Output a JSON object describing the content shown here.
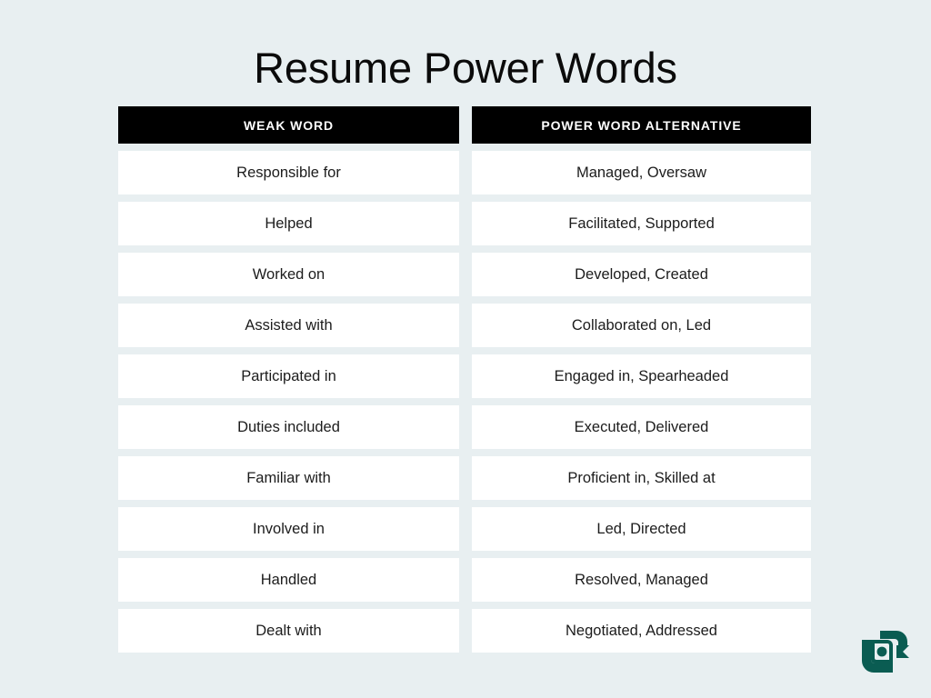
{
  "slide": {
    "title": "Resume Power Words",
    "background_color": "#e8eff1",
    "header_bg_color": "#000000",
    "header_text_color": "#ffffff",
    "cell_bg_color": "#ffffff",
    "cell_text_color": "#1c1c1c",
    "logo_color": "#0a5c52"
  },
  "table": {
    "columns": [
      {
        "header": "WEAK WORD"
      },
      {
        "header": "POWER WORD ALTERNATIVE"
      }
    ],
    "rows": [
      {
        "weak_word": "Responsible for",
        "power_word": "Managed, Oversaw"
      },
      {
        "weak_word": "Helped",
        "power_word": "Facilitated, Supported"
      },
      {
        "weak_word": "Worked on",
        "power_word": "Developed, Created"
      },
      {
        "weak_word": "Assisted with",
        "power_word": "Collaborated on, Led"
      },
      {
        "weak_word": "Participated in",
        "power_word": "Engaged in, Spearheaded"
      },
      {
        "weak_word": "Duties included",
        "power_word": "Executed, Delivered"
      },
      {
        "weak_word": "Familiar with",
        "power_word": "Proficient in, Skilled at"
      },
      {
        "weak_word": "Involved in",
        "power_word": "Led, Directed"
      },
      {
        "weak_word": "Handled",
        "power_word": "Resolved, Managed"
      },
      {
        "weak_word": "Dealt with",
        "power_word": "Negotiated, Addressed"
      }
    ]
  },
  "logo": {
    "name": "brand-logo"
  }
}
